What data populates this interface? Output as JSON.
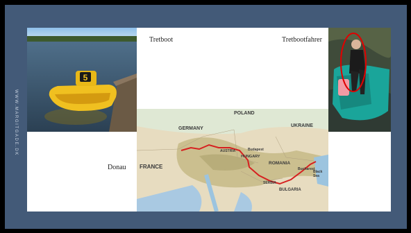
{
  "slide": {
    "side_text": "WWW.MARGITGADE.DK",
    "background_color": "#435a78"
  },
  "labels": {
    "tretboot": "Tretboot",
    "tretbootfahrer": "Tretbootfahrer",
    "donau": "Donau"
  },
  "images": {
    "boat_number": "5"
  },
  "map": {
    "route_color": "#d62020",
    "places": [
      "POLAND",
      "GERMANY",
      "UKRAINE",
      "FRANCE",
      "ROMANIA",
      "BULGARIA",
      "HUNGARY",
      "AUSTRIA",
      "SERBIA",
      "Black Sea",
      "Budapest",
      "Bucharest"
    ]
  }
}
